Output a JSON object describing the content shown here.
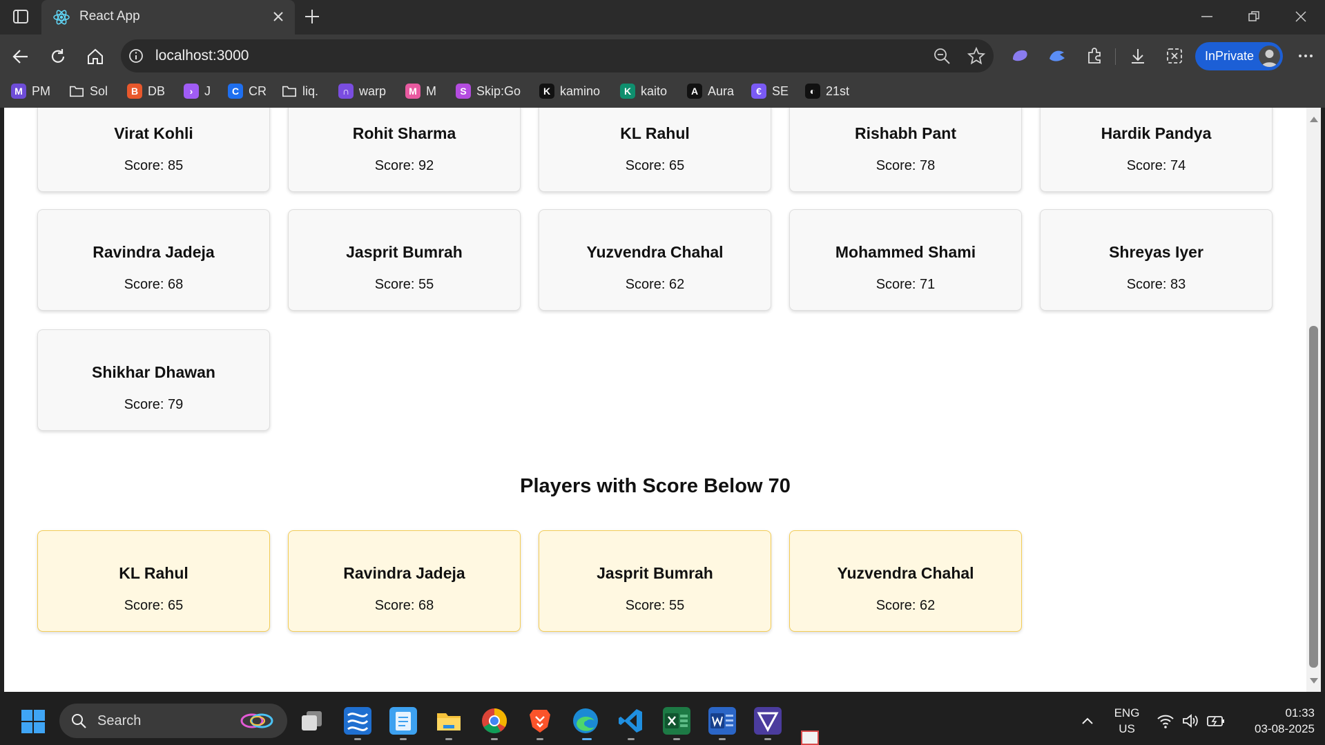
{
  "browser": {
    "tab_title": "React App",
    "url": "localhost:3000",
    "inprivate_label": "InPrivate",
    "bookmarks": [
      {
        "label": "PM",
        "color": "#6e4dd8",
        "glyph": "M"
      },
      {
        "label": "Sol",
        "color": "",
        "glyph": "folder"
      },
      {
        "label": "DB",
        "color": "#e8582c",
        "glyph": "B"
      },
      {
        "label": "J",
        "color": "#a05cf5",
        "glyph": "›"
      },
      {
        "label": "CR",
        "color": "#1e6ff0",
        "glyph": "C"
      },
      {
        "label": "liq.",
        "color": "",
        "glyph": "folder"
      },
      {
        "label": "warp",
        "color": "#7a4de0",
        "glyph": "∩"
      },
      {
        "label": "M",
        "color": "#e85aa0",
        "glyph": "M"
      },
      {
        "label": "Skip:Go",
        "color": "#b44ce0",
        "glyph": "S"
      },
      {
        "label": "kamino",
        "color": "#111111",
        "glyph": "K"
      },
      {
        "label": "kaito",
        "color": "#0f8f6e",
        "glyph": "K"
      },
      {
        "label": "Aura",
        "color": "#111111",
        "glyph": "A"
      },
      {
        "label": "SE",
        "color": "#7a5af5",
        "glyph": "€"
      },
      {
        "label": "21st",
        "color": "#111111",
        "glyph": "◐"
      }
    ]
  },
  "app": {
    "all_players": [
      {
        "name": "Virat Kohli",
        "score": "Score: 85"
      },
      {
        "name": "Rohit Sharma",
        "score": "Score: 92"
      },
      {
        "name": "KL Rahul",
        "score": "Score: 65"
      },
      {
        "name": "Rishabh Pant",
        "score": "Score: 78"
      },
      {
        "name": "Hardik Pandya",
        "score": "Score: 74"
      },
      {
        "name": "Ravindra Jadeja",
        "score": "Score: 68"
      },
      {
        "name": "Jasprit Bumrah",
        "score": "Score: 55"
      },
      {
        "name": "Yuzvendra Chahal",
        "score": "Score: 62"
      },
      {
        "name": "Mohammed Shami",
        "score": "Score: 71"
      },
      {
        "name": "Shreyas Iyer",
        "score": "Score: 83"
      },
      {
        "name": "Shikhar Dhawan",
        "score": "Score: 79"
      }
    ],
    "below_heading": "Players with Score Below 70",
    "below_players": [
      {
        "name": "KL Rahul",
        "score": "Score: 65"
      },
      {
        "name": "Ravindra Jadeja",
        "score": "Score: 68"
      },
      {
        "name": "Jasprit Bumrah",
        "score": "Score: 55"
      },
      {
        "name": "Yuzvendra Chahal",
        "score": "Score: 62"
      }
    ]
  },
  "taskbar": {
    "search_placeholder": "Search",
    "lang_top": "ENG",
    "lang_bottom": "US",
    "time": "01:33",
    "date": "03-08-2025"
  }
}
